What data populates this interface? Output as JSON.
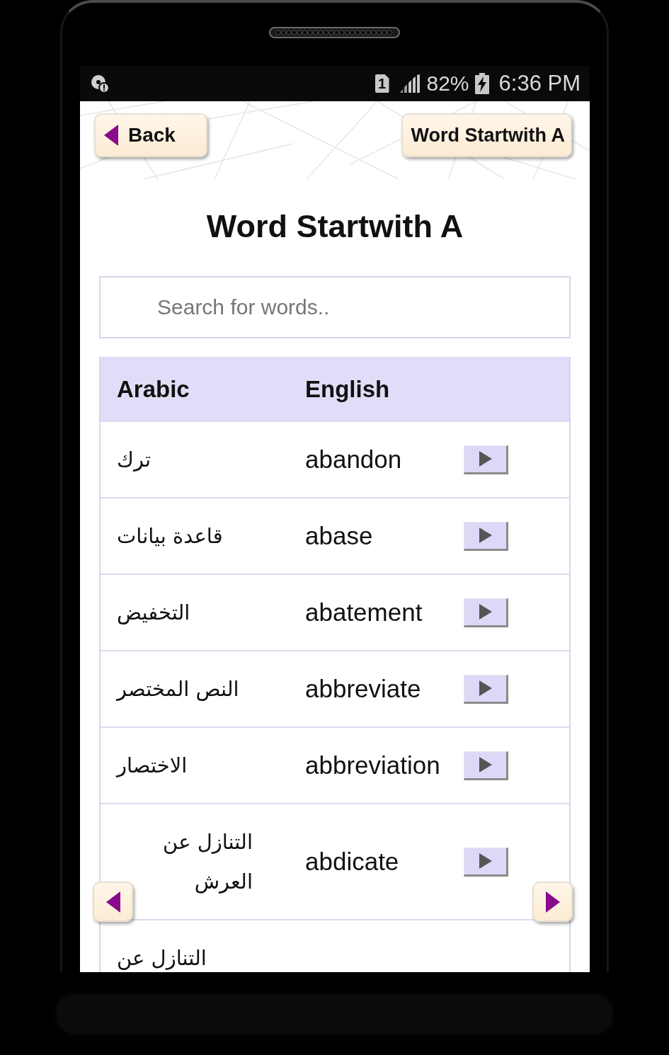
{
  "status_bar": {
    "sim_slot": "1",
    "battery": "82%",
    "charging": true,
    "time": "6:36 PM"
  },
  "header": {
    "back_button": "Back",
    "title_button": "Word Startwith A"
  },
  "heading": "Word Startwith A",
  "search": {
    "placeholder": "Search for words.."
  },
  "table": {
    "header": {
      "arabic": "Arabic",
      "english": "English"
    },
    "rows": [
      {
        "arabic": "ترك",
        "english": "abandon"
      },
      {
        "arabic": "قاعدة بيانات",
        "english": "abase"
      },
      {
        "arabic": "التخفيض",
        "english": "abatement"
      },
      {
        "arabic": "النص المختصر",
        "english": "abbreviate"
      },
      {
        "arabic": "الاختصار",
        "english": "abbreviation"
      },
      {
        "arabic": "التنازل عن العرش",
        "english": "abdicate"
      },
      {
        "arabic": "التنازل عن"
      }
    ]
  }
}
